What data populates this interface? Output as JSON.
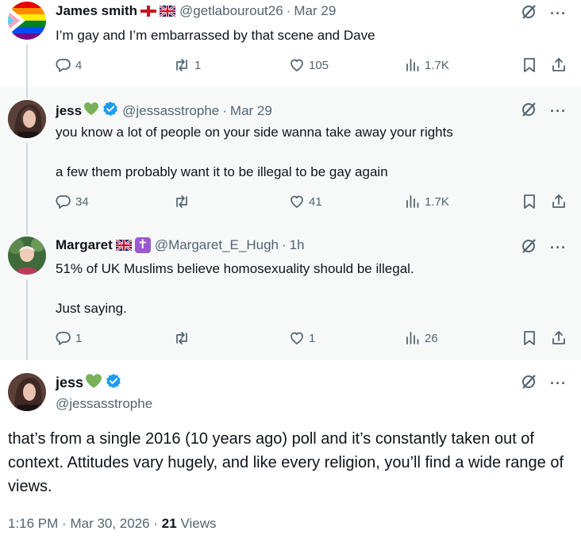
{
  "tweets": [
    {
      "name": "James smith",
      "handle": "@getlabourout26",
      "date": "Mar 29",
      "text": "I’m gay and I’m embarrassed by that scene and Dave",
      "replies": "4",
      "retweets": "1",
      "likes": "105",
      "views": "1.7K"
    },
    {
      "name": "jess",
      "handle": "@jessasstrophe",
      "date": "Mar 29",
      "text": "you know a lot of people on your side wanna take away your rights\n\na few them probably want it to be illegal to be gay again",
      "replies": "34",
      "retweets": "",
      "likes": "41",
      "views": "1.7K"
    },
    {
      "name": "Margaret",
      "handle": "@Margaret_E_Hugh",
      "date": "1h",
      "text": "51% of UK Muslims believe homosexuality should be illegal.\n\nJust saying.",
      "replies": "1",
      "retweets": "",
      "likes": "1",
      "views": "26"
    }
  ],
  "main": {
    "name": "jess",
    "handle": "@jessasstrophe",
    "text": "that’s from a single 2016 (10 years ago) poll and it’s constantly taken out of context. Attitudes vary hugely, and like every religion, you’ll find a wide range of views.",
    "time": "1:16 PM",
    "date": "Mar 30, 2026",
    "views_count": "21",
    "views_label": "Views"
  },
  "symbols": {
    "dot": "·",
    "more": "···",
    "cross": "✝"
  },
  "colors": {
    "verified": "#1d9bf0",
    "secondary_text": "#536471",
    "reply_background": "#f7f9f9",
    "green_heart": "#78b159"
  }
}
